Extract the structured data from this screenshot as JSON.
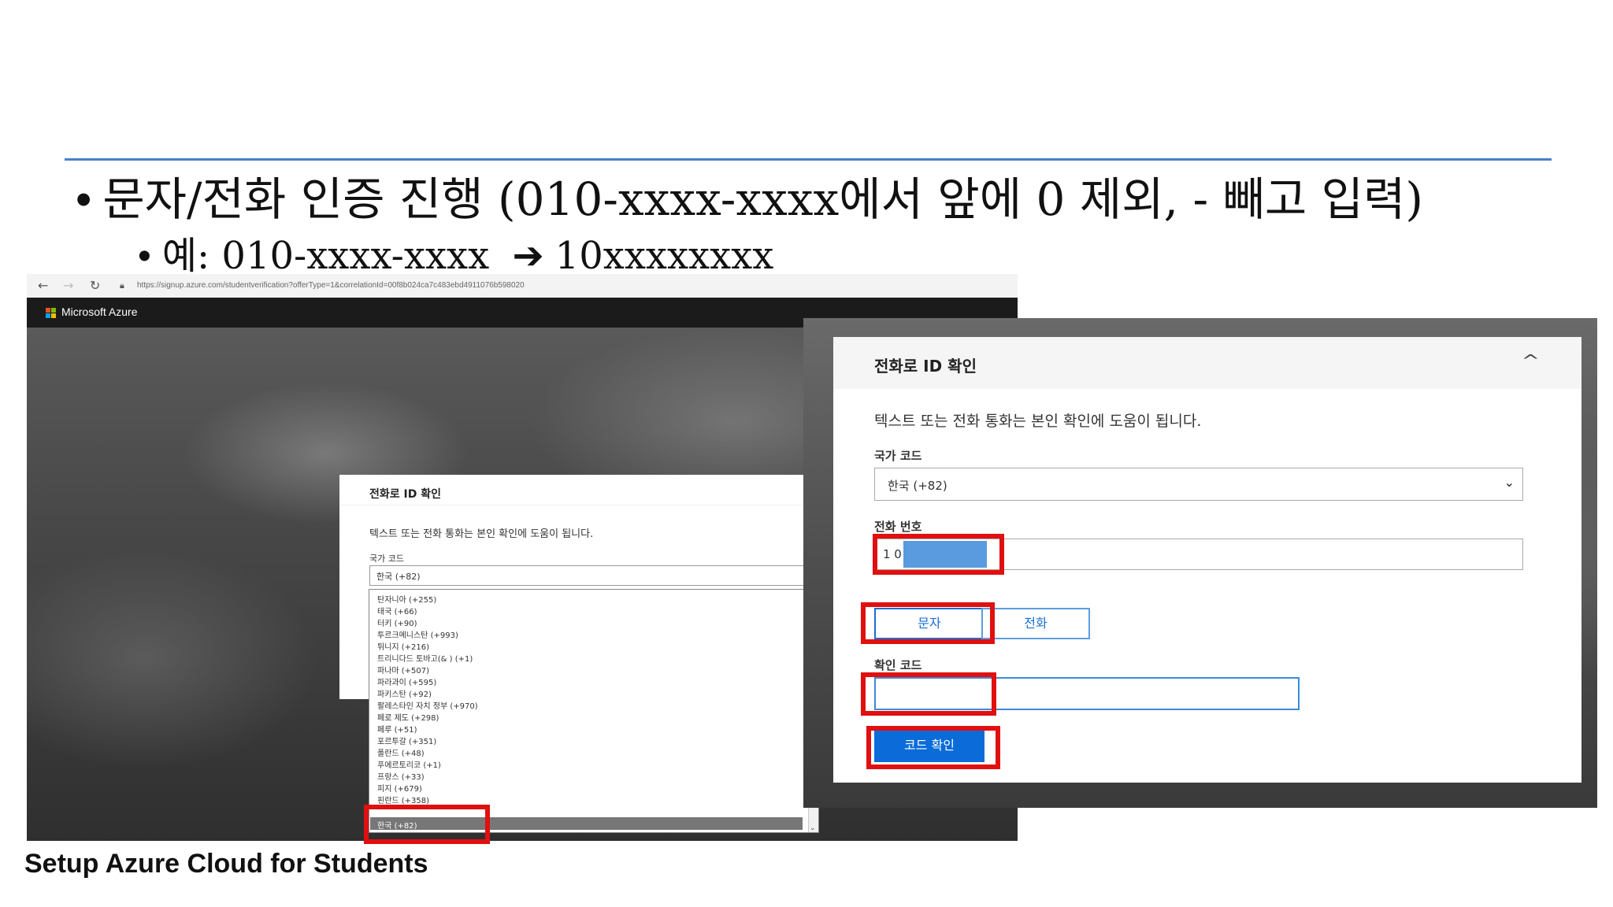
{
  "slide": {
    "bullet_main": "문자/전화 인증 진행 (010-xxxx-xxxx에서 앞에 0 제외, - 빼고 입력)",
    "bullet_sub_prefix": "예: 010-xxxx-xxxx",
    "bullet_sub_arrow": "➔",
    "bullet_sub_suffix": "10xxxxxxxx",
    "footer": "Setup Azure Cloud for Students"
  },
  "browser": {
    "url": "https://signup.azure.com/studentverification?offerType=1&correlationId=00f8b024ca7c483ebd4911076b598020",
    "brand": "Microsoft Azure"
  },
  "dialog_small": {
    "title": "전화로 ID 확인",
    "description": "텍스트 또는 전화 통화는 본인 확인에 도움이 됩니다.",
    "country_label": "국가 코드",
    "country_value": "한국 (+82)",
    "dropdown_options": [
      "탄자니아 (+255)",
      "태국 (+66)",
      "터키 (+90)",
      "투르크메니스탄 (+993)",
      "튀니지 (+216)",
      "트리니다드 토바고(& ) (+1)",
      "파나마 (+507)",
      "파라과이 (+595)",
      "파키스탄 (+92)",
      "팔레스타인 자치 정부 (+970)",
      "페로 제도 (+298)",
      "페루 (+51)",
      "포르투갈 (+351)",
      "폴란드 (+48)",
      "푸에르토리코 (+1)",
      "프랑스 (+33)",
      "피지 (+679)",
      "핀란드 (+358)"
    ],
    "dropdown_selected": "한국 (+82)",
    "scroll_arrow": "⌄"
  },
  "dialog_large": {
    "title": "전화로 ID 확인",
    "collapse_glyph": "^",
    "description": "텍스트 또는 전화 통화는 본인 확인에 도움이 됩니다.",
    "country_label": "국가 코드",
    "country_value": "한국 (+82)",
    "select_arrow": "⌄",
    "phone_label": "전화 번호",
    "phone_value": "1 0",
    "sms_button": "문자",
    "call_button": "전화",
    "code_label": "확인 코드",
    "code_value": "",
    "verify_button": "코드 확인"
  },
  "colors": {
    "accent_blue": "#0b6cd9",
    "highlight_red": "#e01010",
    "rule_blue": "#4a7fc9"
  }
}
